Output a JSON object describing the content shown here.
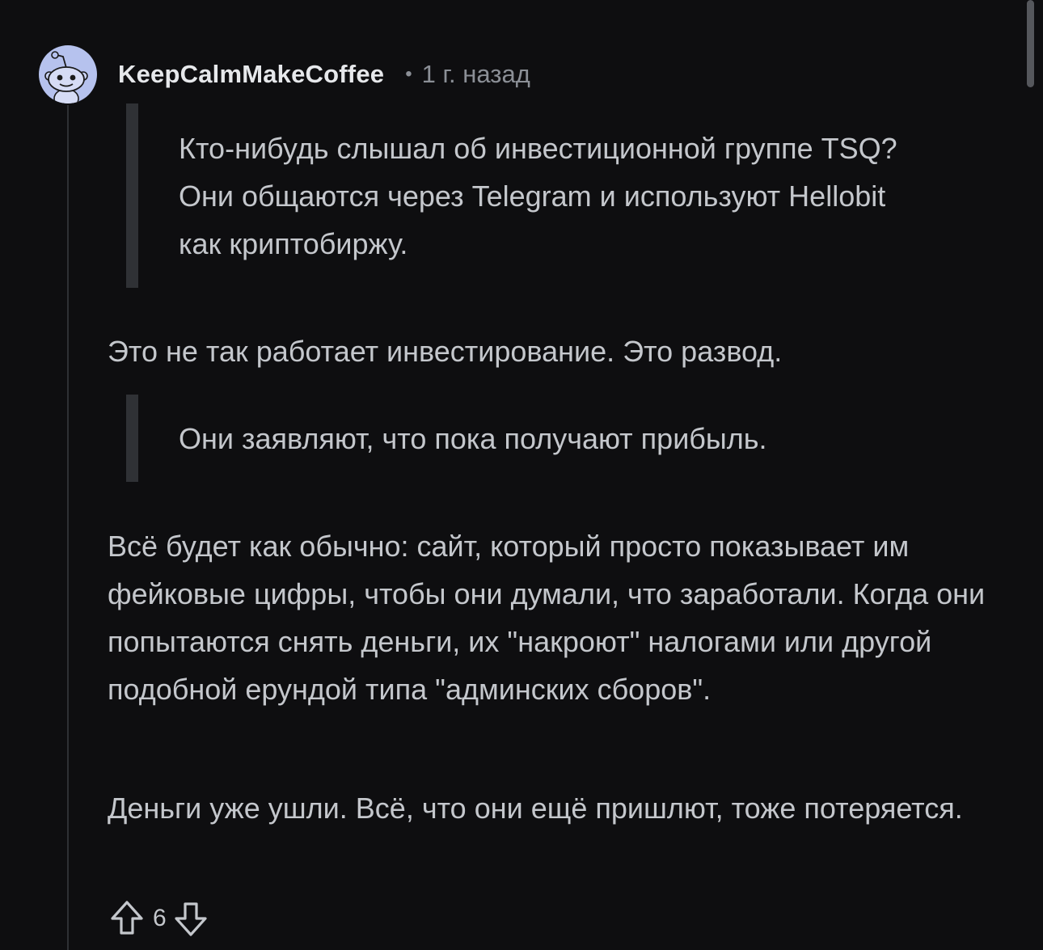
{
  "comment": {
    "author": "KeepCalmMakeCoffee",
    "separator": "•",
    "time_ago": "1 г. назад",
    "avatar_icon": "reddit-snoo-avatar-icon",
    "quote_1": "Кто-нибудь слышал об инвестиционной группе TSQ? Они общаются через Telegram и используют Hellobit как криптобиржу.",
    "paragraph_1": "Это не так работает инвестирование. Это развод.",
    "quote_2": "Они заявляют, что пока получают прибыль.",
    "paragraph_2": "Всё будет как обычно: сайт, который просто показывает им фейковые цифры, чтобы они думали, что заработали. Когда они попытаются снять деньги, их \"накроют\" налогами или другой подобной ерундой типа \"админских сборов\".",
    "paragraph_3": "Деньги уже ушли. Всё, что они ещё пришлют, тоже потеряется.",
    "score": "6",
    "upvote_icon": "upvote-arrow-icon",
    "downvote_icon": "downvote-arrow-icon"
  },
  "colors": {
    "background": "#0e0e10",
    "text": "#c4c7cc",
    "username": "#e6e8eb",
    "muted": "#8b8f96",
    "quote_bar": "#2f3135",
    "avatar_bg": "#b6c2ee"
  }
}
